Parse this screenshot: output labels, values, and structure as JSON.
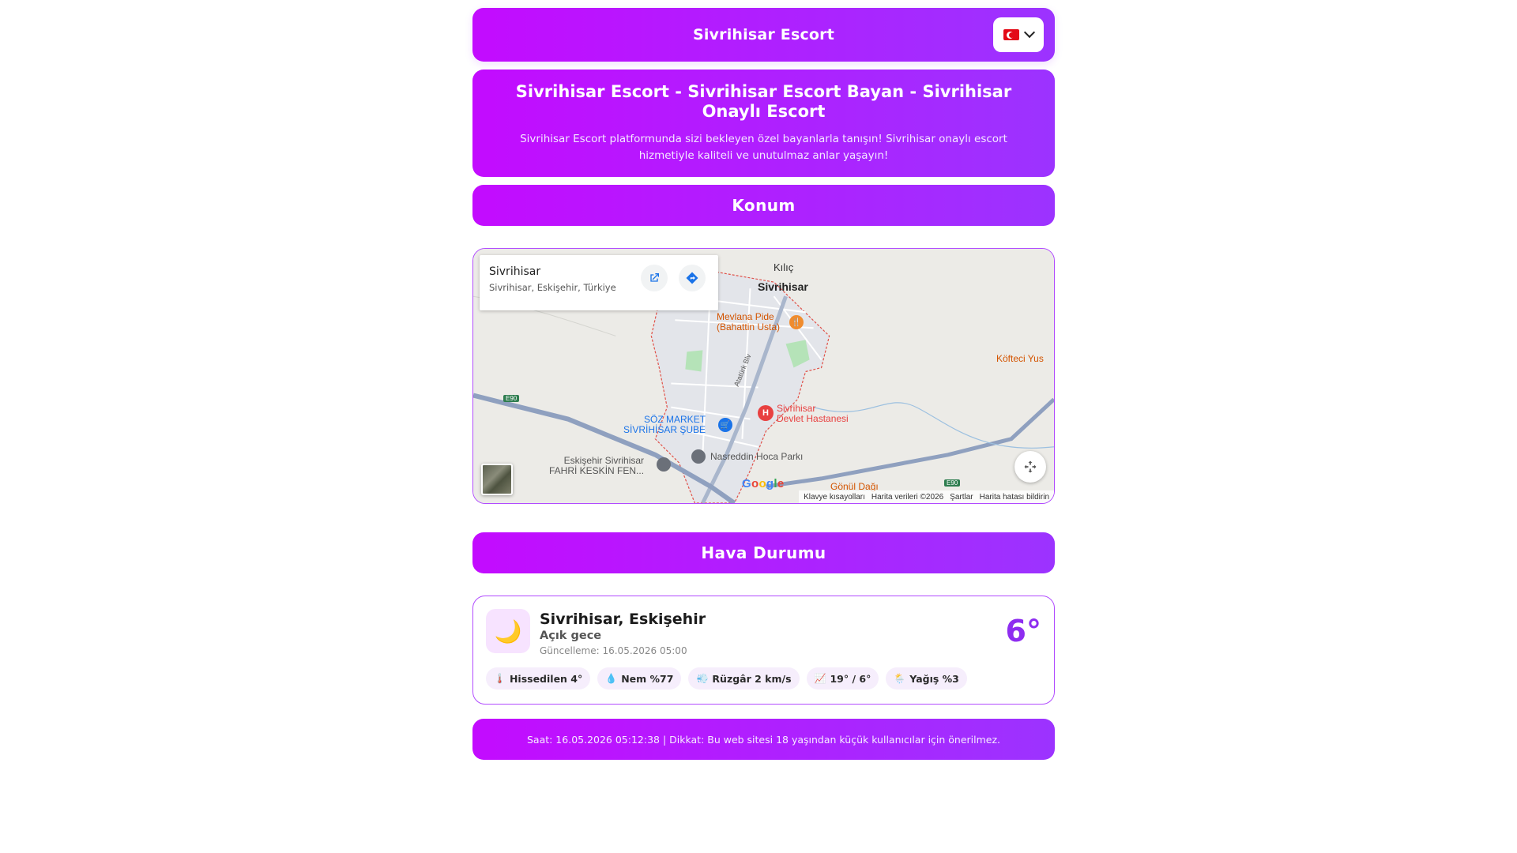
{
  "header": {
    "title": "Sivrihisar Escort",
    "lang_flag_icon": "turkey-flag-icon"
  },
  "hero": {
    "title": "Sivrihisar Escort - Sivrihisar Escort Bayan - Sivrihisar Onaylı Escort",
    "description": "Sivrihisar Escort platformunda sizi bekleyen özel bayanlarla tanışın! Sivrihisar onaylı escort hizmetiyle kaliteli ve unutulmaz anlar yaşayın!"
  },
  "sections": {
    "location": "Konum",
    "weather": "Hava Durumu"
  },
  "map": {
    "place_name": "Sivrihisar",
    "place_address": "Sivrihisar, Eskişehir, Türkiye",
    "google_logo": "Google",
    "labels": {
      "kilic": "Kılıç",
      "town": "Sivrihisar",
      "mevlana_1": "Mevlana Pide",
      "mevlana_2": "(Bahattin Usta)",
      "kofteci": "Köfteci Yus",
      "ataturk": "Atatürk Blv",
      "e90_a": "E90",
      "e90_b": "E90",
      "soz_1": "SÖZ MARKET",
      "soz_2": "SİVRİHİSAR ŞUBE",
      "hosp_1": "Sivrihisar",
      "hosp_2": "Devlet Hastanesi",
      "park": "Nasreddin Hoca Parkı",
      "school_1": "Eskişehir Sivrihisar",
      "school_2": "FAHRİ KESKİN FEN...",
      "gonul": "Gönül Dağı"
    },
    "attribution": {
      "shortcuts": "Klavye kısayolları",
      "data": "Harita verileri ©2026",
      "terms": "Şartlar",
      "report": "Harita hatası bildirin"
    }
  },
  "weather": {
    "icon": "🌙",
    "location": "Sivrihisar, Eskişehir",
    "description": "Açık gece",
    "updated": "Güncelleme: 16.05.2026 05:00",
    "temperature": "6°",
    "chips": [
      {
        "icon": "🌡️",
        "label": "Hissedilen 4°"
      },
      {
        "icon": "💧",
        "label": "Nem %77"
      },
      {
        "icon": "💨",
        "label": "Rüzgâr 2 km/s"
      },
      {
        "icon": "📈",
        "label": "19° / 6°"
      },
      {
        "icon": "🌦️",
        "label": "Yağış %3"
      }
    ]
  },
  "footer": {
    "text": "Saat: 16.05.2026 05:12:38 | Dikkat: Bu web sitesi 18 yaşından küçük kullanıcılar için önerilmez."
  },
  "colors": {
    "gradient_start": "#c30bff",
    "gradient_end": "#9c33ff",
    "temp": "#8e2df0"
  }
}
